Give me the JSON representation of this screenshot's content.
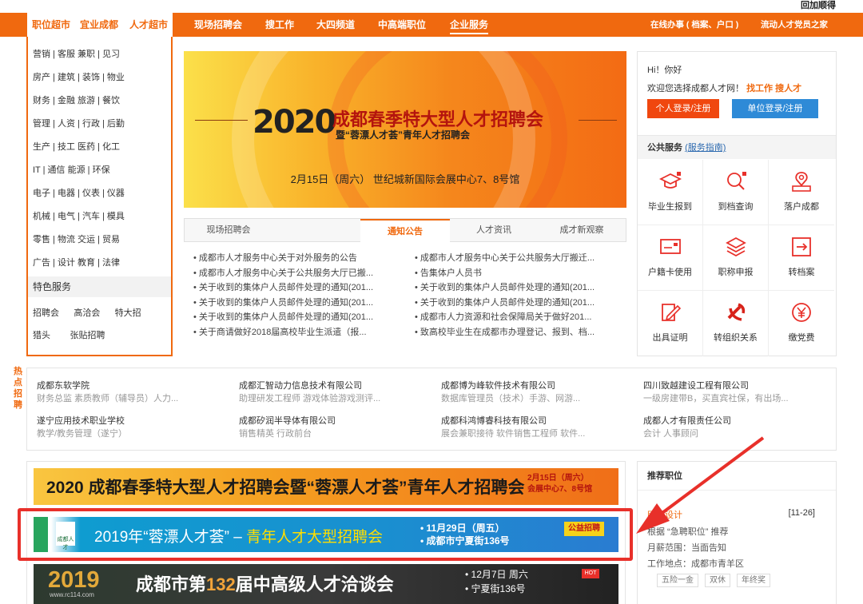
{
  "top": {
    "qr_text": "回加顺得"
  },
  "nav": {
    "tabs": [
      "职位超市",
      "宜业成都",
      "人才超市",
      "现场招聘会",
      "搜工作",
      "大四频道",
      "中高端职位",
      "企业服务"
    ],
    "right_links": [
      "在线办事 ( 档案、户口 )",
      "流动人才党员之家"
    ]
  },
  "left_nav": {
    "rows": [
      "营销 | 客服   兼职 | 见习",
      "房产 | 建筑 | 装饰 | 物业",
      "财务 | 金融   旅游 | 餐饮",
      "管理 | 人资 | 行政 | 后勤",
      "生产 | 技工   医药 | 化工",
      "IT   | 通信   能源 | 环保",
      "电子 | 电器 | 仪表 | 仪器",
      "机械 | 电气 | 汽车 | 模具",
      "零售 | 物流   交运 | 贸易",
      "广告 | 设计   教育 | 法律"
    ],
    "special_title": "特色服务",
    "special_rows": [
      "招聘会      高洽会      特大招",
      "猎头        张贴招聘"
    ]
  },
  "banner": {
    "year": "2020",
    "title": "成都春季特大型人才招聘会",
    "subtitle": "暨“蓉漂人才荟”青年人才招聘会",
    "date": "2月15日（周六）   世纪城新国际会展中心7、8号馆"
  },
  "news_tabs": [
    "现场招聘会",
    "通知公告",
    "人才资讯",
    "成才新观察"
  ],
  "news_left": [
    "• 成都市人才服务中心关于对外服务的公告",
    "• 成都市人才服务中心关于公共服务大厅已搬...",
    "• 关于收到的集体户人员邮件处理的通知(201...",
    "• 关于收到的集体户人员邮件处理的通知(201...",
    "• 关于收到的集体户人员邮件处理的通知(201...",
    "• 关于商请做好2018届高校毕业生派遣（报..."
  ],
  "news_right": [
    "• 成都市人才服务中心关于公共服务大厅搬迁...",
    "• 告集体户人员书",
    "• 关于收到的集体户人员邮件处理的通知(201...",
    "• 关于收到的集体户人员邮件处理的通知(201...",
    "• 成都市人力资源和社会保障局关于做好201...",
    "• 致高校毕业生在成都市办理登记、报到、档..."
  ],
  "user_box": {
    "hi": "Hi！你好",
    "welcome": "欢迎您选择成都人才网！",
    "find_job": "找工作",
    "find_talent": "搜人才",
    "personal_login": "个人登录/注册",
    "company_login": "单位登录/注册",
    "public_service": "公共服务",
    "service_guide": "(服务指南)"
  },
  "services": [
    {
      "label": "毕业生报到",
      "icon": "graduation-cap-icon"
    },
    {
      "label": "到档查询",
      "icon": "search-icon"
    },
    {
      "label": "落户成都",
      "icon": "location-pin-icon"
    },
    {
      "label": "户籍卡使用",
      "icon": "card-icon"
    },
    {
      "label": "职称申报",
      "icon": "layers-icon"
    },
    {
      "label": "转档案",
      "icon": "transfer-icon"
    },
    {
      "label": "出具证明",
      "icon": "edit-document-icon"
    },
    {
      "label": "转组织关系",
      "icon": "party-emblem-icon"
    },
    {
      "label": "缴党费",
      "icon": "yuan-coin-icon"
    }
  ],
  "hot": {
    "label": "热点招聘",
    "companies": [
      {
        "name": "成都东软学院",
        "jobs": "财务总监 素质教师（辅导员）人力..."
      },
      {
        "name": "成都汇智动力信息技术有限公司",
        "jobs": "助理研发工程师 游戏体验游戏测评..."
      },
      {
        "name": "成都博为峰软件技术有限公司",
        "jobs": "数据库管理员（技术）手游、网游..."
      },
      {
        "name": "四川致越建设工程有限公司",
        "jobs": "一级房建带B，买直宾社保，有出场..."
      },
      {
        "name": "遂宁应用技术职业学校",
        "jobs": "教学/教务管理（遂宁）"
      },
      {
        "name": "成都矽润半导体有限公司",
        "jobs": "销售精英 行政前台"
      },
      {
        "name": "成都科鸿博睿科技有限公司",
        "jobs": "展会兼职接待 软件销售工程师 软件..."
      },
      {
        "name": "成都人才有限责任公司",
        "jobs": "会计 人事顾问"
      }
    ]
  },
  "ads": {
    "ad1_text": "2020 成都春季特大型人才招聘会暨“蓉漂人才荟”青年人才招聘会",
    "ad1_date1": "2月15日（周六）",
    "ad1_date2": "会展中心7、8号馆",
    "ad2_logo": "成都人才",
    "ad2_text_a": "2019年“蓉漂人才荟” – ",
    "ad2_text_b": "青年人才大型招聘会",
    "ad2_date1": "• 11月29日（周五）",
    "ad2_date2": "• 成都市宁夏街136号",
    "ad2_tag": "公益招聘",
    "ad3_year": "2019",
    "ad3_url": "www.rc114.com",
    "ad3_text_a": "成都市第",
    "ad3_num": "132",
    "ad3_text_b": "届中高级人才洽谈会",
    "ad3_date1": "• 12月7日 周六",
    "ad3_date2": "• 宁夏街136号",
    "ad3_hot": "HOT"
  },
  "recommend": {
    "title": "推荐职位",
    "job": "网页设计",
    "job_date": "[11-26]",
    "reason": "根据 “急聘职位” 推荐",
    "salary": "月薪范围：当面告知",
    "location": "工作地点：成都市青羊区",
    "tags": [
      "五险一金",
      "双休",
      "年终奖"
    ]
  },
  "colors": {
    "brand": "#f0690f",
    "highlight_box": "#e8302a"
  }
}
